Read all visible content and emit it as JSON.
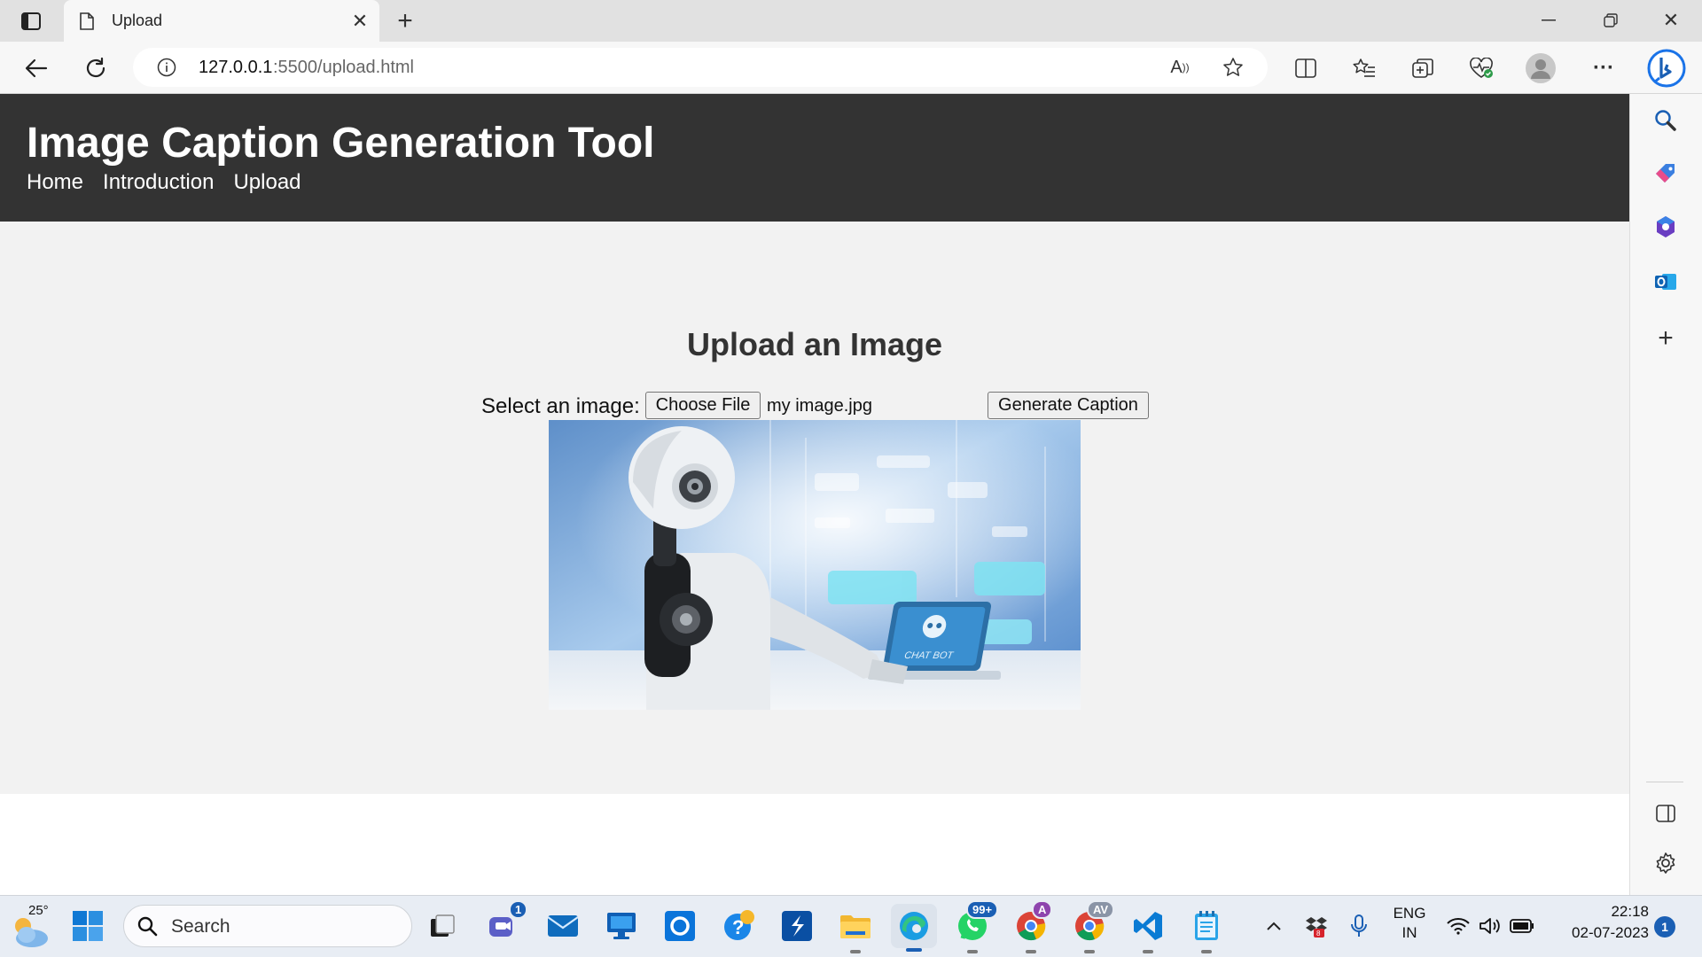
{
  "browser": {
    "tab_title": "Upload",
    "url_host": "127.0.0.1",
    "url_rest": ":5500/upload.html"
  },
  "site": {
    "title": "Image Caption Generation Tool",
    "nav": [
      "Home",
      "Introduction",
      "Upload"
    ]
  },
  "upload": {
    "heading": "Upload an Image",
    "select_label": "Select an image:",
    "choose_file_label": "Choose File",
    "file_name": "my image.jpg",
    "generate_label": "Generate Caption",
    "preview_text": "CHAT BOT"
  },
  "taskbar": {
    "weather_temp": "25°",
    "search_placeholder": "Search",
    "teams_badge": "1",
    "whatsapp_badge": "99+",
    "chrome_profile_a": "A",
    "chrome_profile_av": "AV",
    "lang_line1": "ENG",
    "lang_line2": "IN",
    "time": "22:18",
    "date": "02-07-2023",
    "notification_count": "1"
  },
  "colors": {
    "header_bg": "#333333",
    "page_bg": "#f2f2f2",
    "accent": "#1a5fb4"
  }
}
